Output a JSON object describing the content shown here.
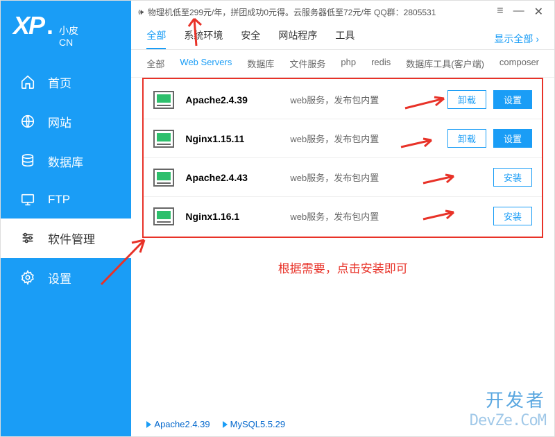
{
  "logo": {
    "main": "XP",
    "dot": ".",
    "top": "小皮",
    "bottom": "CN"
  },
  "topbar": {
    "ad": "物理机低至299元/年，拼团成功0元得。云服务器低至72元/年  QQ群：2805531"
  },
  "tabs": {
    "items": [
      "全部",
      "系统环境",
      "安全",
      "网站程序",
      "工具"
    ],
    "right": "显示全部"
  },
  "subtabs": [
    "全部",
    "Web Servers",
    "数据库",
    "文件服务",
    "php",
    "redis",
    "数据库工具(客户端)",
    "composer"
  ],
  "nav": [
    {
      "label": "首页"
    },
    {
      "label": "网站"
    },
    {
      "label": "数据库"
    },
    {
      "label": "FTP"
    },
    {
      "label": "软件管理"
    },
    {
      "label": "设置"
    }
  ],
  "rows": [
    {
      "name": "Apache2.4.39",
      "desc": "web服务，发布包内置",
      "installed": true
    },
    {
      "name": "Nginx1.15.11",
      "desc": "web服务，发布包内置",
      "installed": true
    },
    {
      "name": "Apache2.4.43",
      "desc": "web服务，发布包内置",
      "installed": false
    },
    {
      "name": "Nginx1.16.1",
      "desc": "web服务，发布包内置",
      "installed": false
    }
  ],
  "btnLabels": {
    "uninstall": "卸载",
    "settings": "设置",
    "install": "安装"
  },
  "note": "根据需要，点击安装即可",
  "status": [
    "Apache2.4.39",
    "MySQL5.5.29"
  ],
  "watermark": {
    "line1": "开发者",
    "line2": "DevZe.CoM"
  }
}
